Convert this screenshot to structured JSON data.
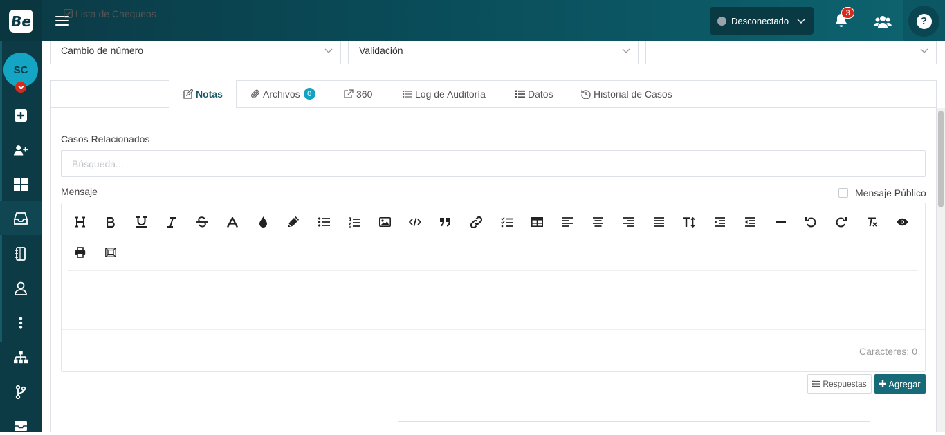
{
  "header": {
    "logo_text": "Be",
    "status": {
      "label": "Desconectado",
      "dot_color": "#9aa4a8"
    },
    "notifications_count": "3"
  },
  "sidebar": {
    "avatar_initials": "SC",
    "items": [
      {
        "icon": "plus-square-icon"
      },
      {
        "icon": "user-plus-icon"
      },
      {
        "icon": "grid-icon"
      },
      {
        "icon": "inbox-icon",
        "active": true
      },
      {
        "icon": "notebook-icon"
      },
      {
        "icon": "user-icon"
      },
      {
        "icon": "more-vertical-icon"
      },
      {
        "icon": "sitemap-icon"
      },
      {
        "icon": "branch-icon"
      },
      {
        "icon": "inbox-stack-icon"
      }
    ]
  },
  "filters": {
    "select1": "Cambio de número",
    "select2": "Validación",
    "select3": ""
  },
  "tabs": [
    {
      "label": "Lista de Chequeos",
      "icon": "check-square-icon"
    },
    {
      "label": "Notas",
      "icon": "edit-icon",
      "active": true
    },
    {
      "label": "Archivos",
      "icon": "paperclip-icon",
      "badge": "0"
    },
    {
      "label": "360",
      "icon": "external-link-icon"
    },
    {
      "label": "Log de Auditoría",
      "icon": "list-icon"
    },
    {
      "label": "Datos",
      "icon": "list-ul-icon"
    },
    {
      "label": "Historial de Casos",
      "icon": "history-icon"
    }
  ],
  "notes": {
    "related_label": "Casos Relacionados",
    "search_placeholder": "Búsqueda...",
    "message_label": "Mensaje",
    "public_label": "Mensaje Público",
    "char_count": "Caracteres: 0",
    "responses_button": "Respuestas",
    "add_button": "Agregar"
  },
  "colors": {
    "accent": "#176b78",
    "header_dark": "#0b3a45",
    "badge_red": "#d42b1e",
    "info": "#13a3c2"
  }
}
